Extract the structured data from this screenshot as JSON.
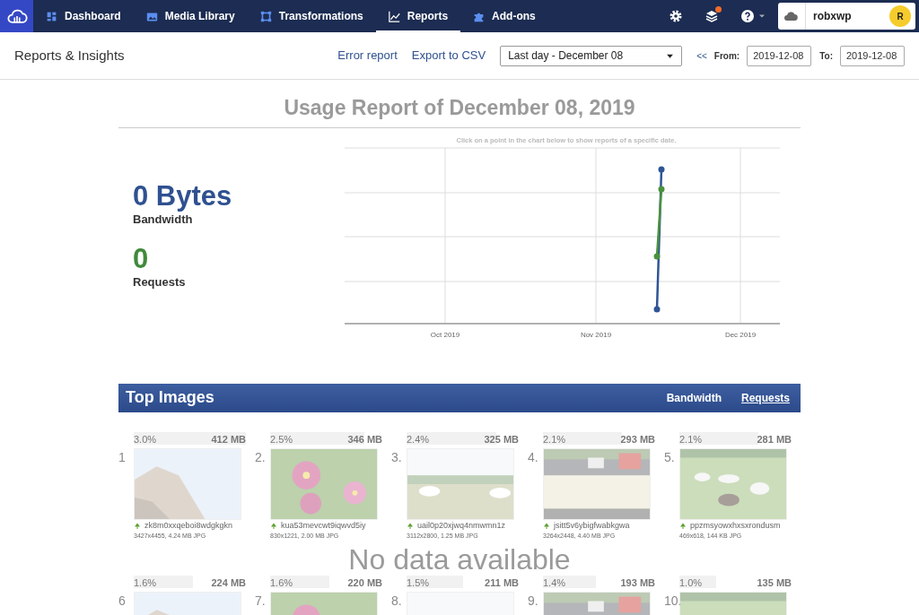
{
  "nav": {
    "items": [
      {
        "label": "Dashboard",
        "selected": false
      },
      {
        "label": "Media Library",
        "selected": false
      },
      {
        "label": "Transformations",
        "selected": false
      },
      {
        "label": "Reports",
        "selected": true
      },
      {
        "label": "Add-ons",
        "selected": false
      }
    ],
    "notification": true,
    "account": {
      "name": "robxwp",
      "initial": "R"
    }
  },
  "header": {
    "title": "Reports & Insights",
    "links": [
      "Error report",
      "Export to CSV"
    ],
    "range": "Last day - December 08",
    "back": "<<",
    "from_label": "From:",
    "from": "2019-12-08",
    "to_label": "To:",
    "to": "2019-12-08"
  },
  "report": {
    "title": "Usage Report of December 08, 2019",
    "stats": [
      {
        "value": "0 Bytes",
        "label": "Bandwidth",
        "color": "#2f5190"
      },
      {
        "value": "0",
        "label": "Requests",
        "color": "#3f8a3a"
      }
    ],
    "chart": {
      "hint": "Click on a point in the chart below to show reports of a specific date.",
      "x_labels": [
        "Oct 2019",
        "Nov 2019",
        "Dec 2019"
      ],
      "series": [
        {
          "color": "#2f5596"
        },
        {
          "color": "#4a923c"
        }
      ]
    }
  },
  "top_images": {
    "title": "Top Images",
    "tabs": [
      {
        "label": "Bandwidth",
        "selected": true
      },
      {
        "label": "Requests",
        "selected": false
      }
    ],
    "empty_message": "No data available",
    "items": [
      {
        "rank": "1",
        "share": "3.0%",
        "size": "412 MB",
        "level": 1.0,
        "name": "zk8m0xxqeboi8wdgkgkn",
        "info": "3427x4455, 4.24 MB JPG"
      },
      {
        "rank": "2.",
        "share": "2.5%",
        "size": "346 MB",
        "level": 0.84,
        "name": "kua53mevcwt9iqwvd5iy",
        "info": "830x1221, 2.00 MB JPG"
      },
      {
        "rank": "3.",
        "share": "2.4%",
        "size": "325 MB",
        "level": 0.8,
        "name": "uail0p20xjwq4nmwmn1z",
        "info": "3112x2800, 1.25 MB JPG"
      },
      {
        "rank": "4.",
        "share": "2.1%",
        "size": "293 MB",
        "level": 0.7,
        "name": "jsitt5v6ybigfwabkgwa",
        "info": "3264x2448, 4.40 MB JPG"
      },
      {
        "rank": "5.",
        "share": "2.1%",
        "size": "281 MB",
        "level": 0.7,
        "name": "ppzmsyowxhxsxrondusm",
        "info": "469x618, 144 KB JPG"
      },
      {
        "rank": "6",
        "share": "1.6%",
        "size": "224 MB",
        "level": 0.53
      },
      {
        "rank": "7.",
        "share": "1.6%",
        "size": "220 MB",
        "level": 0.53
      },
      {
        "rank": "8.",
        "share": "1.5%",
        "size": "211 MB",
        "level": 0.5
      },
      {
        "rank": "9.",
        "share": "1.4%",
        "size": "193 MB",
        "level": 0.47
      },
      {
        "rank": "10.",
        "share": "1.0%",
        "size": "135 MB",
        "level": 0.33
      }
    ]
  }
}
